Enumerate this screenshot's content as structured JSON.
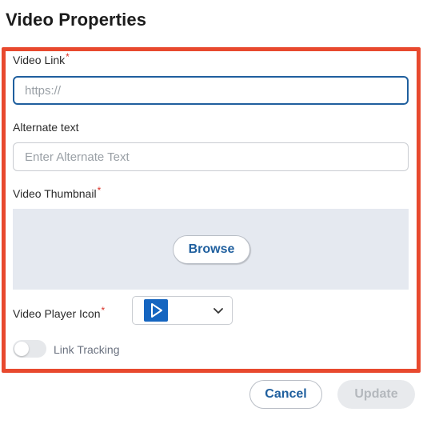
{
  "dialog": {
    "title": "Video Properties"
  },
  "video_link": {
    "label": "Video Link",
    "required_mark": "*",
    "placeholder": "https://",
    "value": ""
  },
  "alternate_text": {
    "label": "Alternate text",
    "placeholder": "Enter Alternate Text",
    "value": ""
  },
  "video_thumbnail": {
    "label": "Video Thumbnail",
    "required_mark": "*",
    "browse_label": "Browse"
  },
  "video_player_icon": {
    "label": "Video Player Icon",
    "required_mark": "*",
    "selected_icon": "play-icon",
    "selected_color": "#1565c0"
  },
  "link_tracking": {
    "label": "Link Tracking",
    "enabled": false
  },
  "footer": {
    "cancel_label": "Cancel",
    "update_label": "Update"
  },
  "colors": {
    "accent": "#1f5f9e",
    "highlight_frame": "#e8492e",
    "required": "#d93025"
  }
}
